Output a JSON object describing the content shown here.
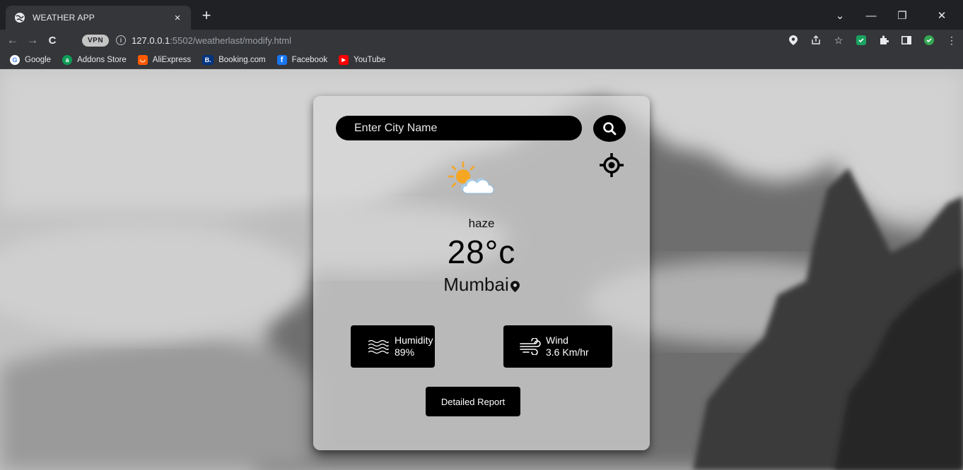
{
  "browser": {
    "tab_title": "WEATHER APP",
    "tab_close": "×",
    "new_tab": "+",
    "window_controls": {
      "chevron": "⌄",
      "minimize": "—",
      "restore": "❐",
      "close": "✕"
    },
    "nav": {
      "back": "←",
      "forward": "→",
      "reload": "C"
    },
    "vpn_label": "VPN",
    "url_host": "127.0.0.1",
    "url_rest": ":5502/weatherlast/modify.html",
    "bookmarks": [
      {
        "label": "Google",
        "color": "#ffffff",
        "glyph": "G"
      },
      {
        "label": "Addons Store",
        "color": "#0f9d58",
        "glyph": "a"
      },
      {
        "label": "AliExpress",
        "color": "#ff5a00",
        "glyph": "◡"
      },
      {
        "label": "Booking.com",
        "color": "#003580",
        "glyph": "B."
      },
      {
        "label": "Facebook",
        "color": "#1877f2",
        "glyph": "f"
      },
      {
        "label": "YouTube",
        "color": "#ff0000",
        "glyph": "▶"
      }
    ]
  },
  "app": {
    "search_placeholder": "Enter City Name",
    "condition": "haze",
    "temperature": "28°c",
    "city": "Mumbai",
    "humidity": {
      "label": "Humidity",
      "value": "89%"
    },
    "wind": {
      "label": "Wind",
      "value": "3.6 Km/hr"
    },
    "report_button": "Detailed Report"
  },
  "colors": {
    "chrome_dark": "#202124",
    "chrome_toolbar": "#35363a",
    "card_bg": "#d7d7d7",
    "button_bg": "#000000",
    "sun": "#f5a623",
    "cloud": "#a8d4f0"
  }
}
